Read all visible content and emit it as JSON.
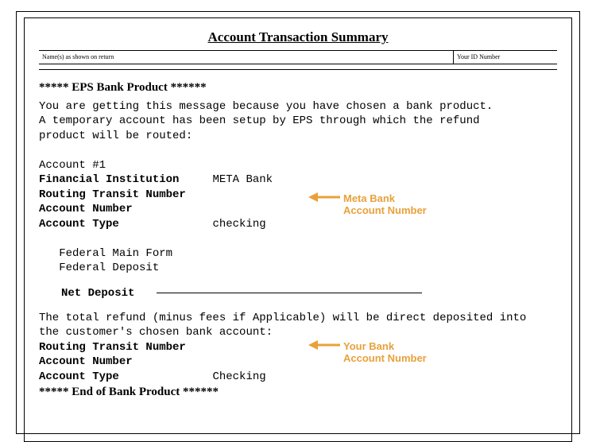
{
  "title": "Account Transaction Summary",
  "header": {
    "nameLabel": "Name(s) as shown on return",
    "idLabel": "Your ID Number"
  },
  "section": {
    "openMarker": "***** EPS Bank Product ******",
    "intro1": "You are getting this message because you have chosen a bank product.",
    "intro2": "A temporary account has been setup by EPS through which the refund",
    "intro3": "product will be routed:",
    "accountHeading": "Account #1",
    "fiLabel": "Financial Institution",
    "fiValue": "META Bank",
    "rtnLabel": "Routing Transit Number",
    "acctNumLabel": "Account Number",
    "acctTypeLabel": "Account Type",
    "acctTypeValue1": "checking",
    "federalMain": "Federal Main Form",
    "federalDeposit": "Federal Deposit",
    "netDeposit": "Net Deposit",
    "refundLine1": "The total refund (minus fees if Applicable) will be direct deposited into",
    "refundLine2": "the customer's chosen bank account:",
    "acctTypeValue2": "Checking",
    "closeMarker": "***** End of Bank Product ******"
  },
  "annotations": {
    "meta1": "Meta Bank",
    "meta2": "Account Number",
    "your1": "Your Bank",
    "your2": "Account Number"
  }
}
